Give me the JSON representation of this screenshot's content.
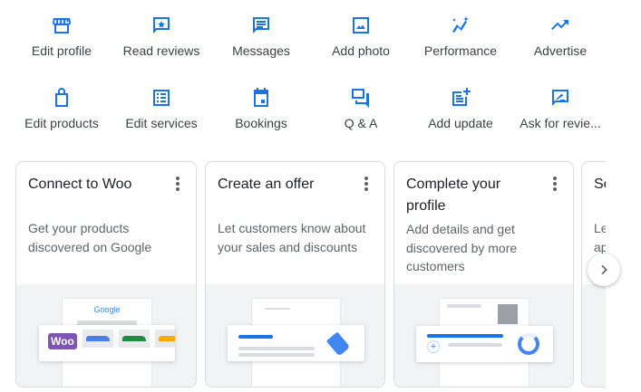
{
  "actions": [
    {
      "label": "Edit profile",
      "icon": "storefront-icon"
    },
    {
      "label": "Read reviews",
      "icon": "review-star-icon"
    },
    {
      "label": "Messages",
      "icon": "message-icon"
    },
    {
      "label": "Add photo",
      "icon": "photo-icon"
    },
    {
      "label": "Performance",
      "icon": "performance-icon"
    },
    {
      "label": "Advertise",
      "icon": "trending-up-icon"
    },
    {
      "label": "Edit products",
      "icon": "shopping-bag-icon"
    },
    {
      "label": "Edit services",
      "icon": "list-icon"
    },
    {
      "label": "Bookings",
      "icon": "calendar-icon"
    },
    {
      "label": "Q & A",
      "icon": "forum-icon"
    },
    {
      "label": "Add update",
      "icon": "post-add-icon"
    },
    {
      "label": "Ask for revie...",
      "icon": "rate-review-icon"
    }
  ],
  "cards": [
    {
      "title": "Connect to Woo",
      "desc": "Get your products discovered on Google",
      "logo_text": "Google",
      "woo_text": "Woo"
    },
    {
      "title": "Create an offer",
      "desc": "Let customers know about your sales and discounts"
    },
    {
      "title": "Complete your profile",
      "desc": "Add details and get discovered by more customers"
    },
    {
      "title": "Se",
      "desc": "Le ap"
    }
  ],
  "colors": {
    "accent": "#1a73e8",
    "woo": "#7f54b3"
  }
}
